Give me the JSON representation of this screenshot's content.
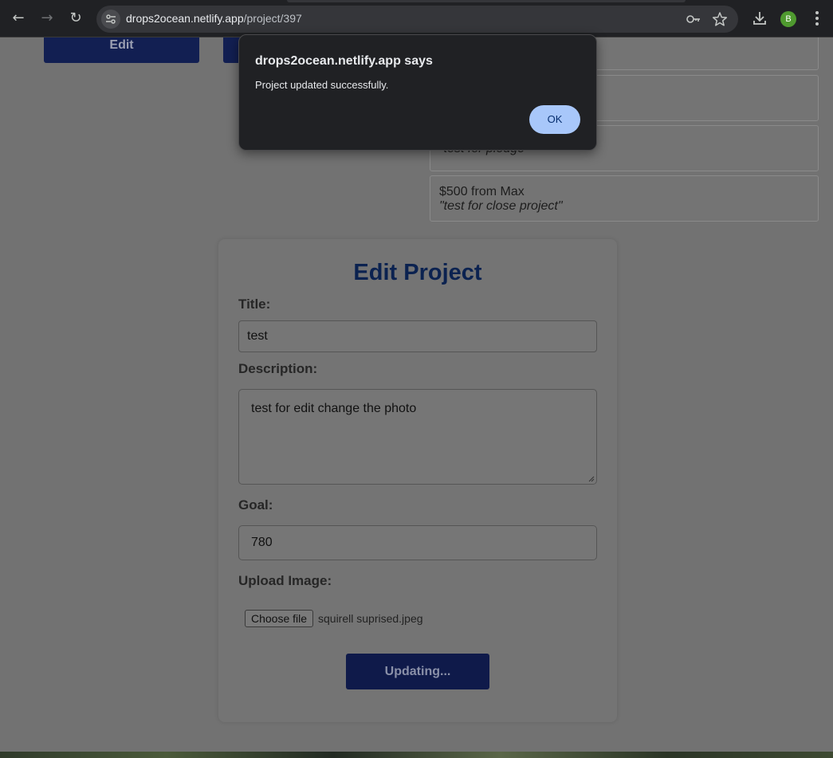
{
  "browser": {
    "url_host": "drops2ocean.netlify.app",
    "url_path": "/project/397",
    "profile_initial": "B"
  },
  "page": {
    "top_buttons": [
      "Edit",
      ""
    ],
    "pledges": [
      {
        "amount_line": "",
        "message": ""
      },
      {
        "amount_line": "",
        "message": ""
      },
      {
        "amount_line": "",
        "message": "\"test for pledge\""
      },
      {
        "amount_line": "$500 from Max",
        "message": "\"test for close project\""
      }
    ],
    "edit_form": {
      "heading": "Edit Project",
      "title_label": "Title:",
      "title_value": "test",
      "description_label": "Description:",
      "description_value": "test for edit change the photo",
      "goal_label": "Goal:",
      "goal_value": "780",
      "image_label": "Upload Image:",
      "choose_file_label": "Choose file",
      "file_name": "squirell suprised.jpeg",
      "submit_label": "Updating..."
    }
  },
  "dialog": {
    "title": "drops2ocean.netlify.app says",
    "message": "Project updated successfully.",
    "ok_label": "OK"
  },
  "colors": {
    "dialog_bg": "#202124",
    "ok_button": "#a8c7fa",
    "heading": "#0b2250",
    "button_navy": "#0f1a4a"
  }
}
